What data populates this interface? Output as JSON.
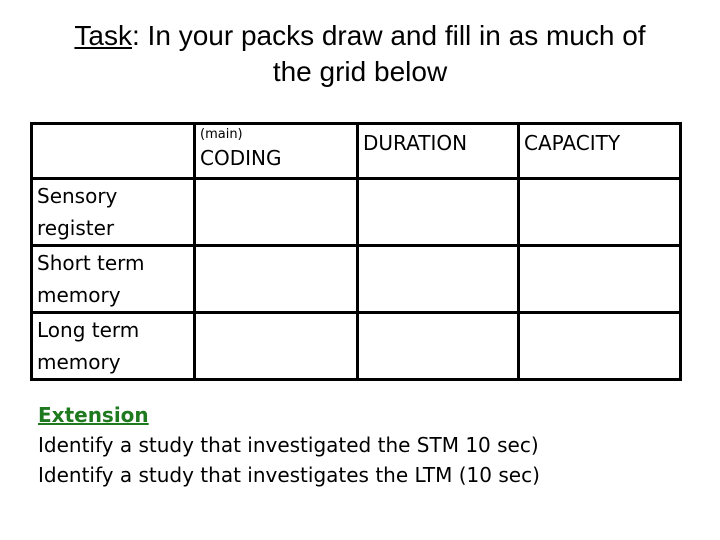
{
  "title": {
    "task_label": "Task",
    "rest_line1": ": In your packs draw and fill in as much of",
    "line2": "the grid below"
  },
  "grid": {
    "headers": [
      {
        "small": "",
        "label": ""
      },
      {
        "small": "(main)",
        "label": "CODING"
      },
      {
        "small": "",
        "label": "DURATION"
      },
      {
        "small": "",
        "label": "CAPACITY"
      }
    ],
    "rows": [
      {
        "label_line1": "Sensory",
        "label_line2": "register",
        "cells": [
          "",
          "",
          ""
        ]
      },
      {
        "label_line1": "Short term",
        "label_line2": "memory",
        "cells": [
          "",
          "",
          ""
        ]
      },
      {
        "label_line1": "Long term",
        "label_line2": "memory",
        "cells": [
          "",
          "",
          ""
        ]
      }
    ]
  },
  "extension": {
    "heading": "Extension",
    "heading_color": "#1f7a1f",
    "lines": [
      "Identify a study that investigated the STM 10 sec)",
      "Identify a study that investigates the LTM (10 sec)"
    ]
  }
}
